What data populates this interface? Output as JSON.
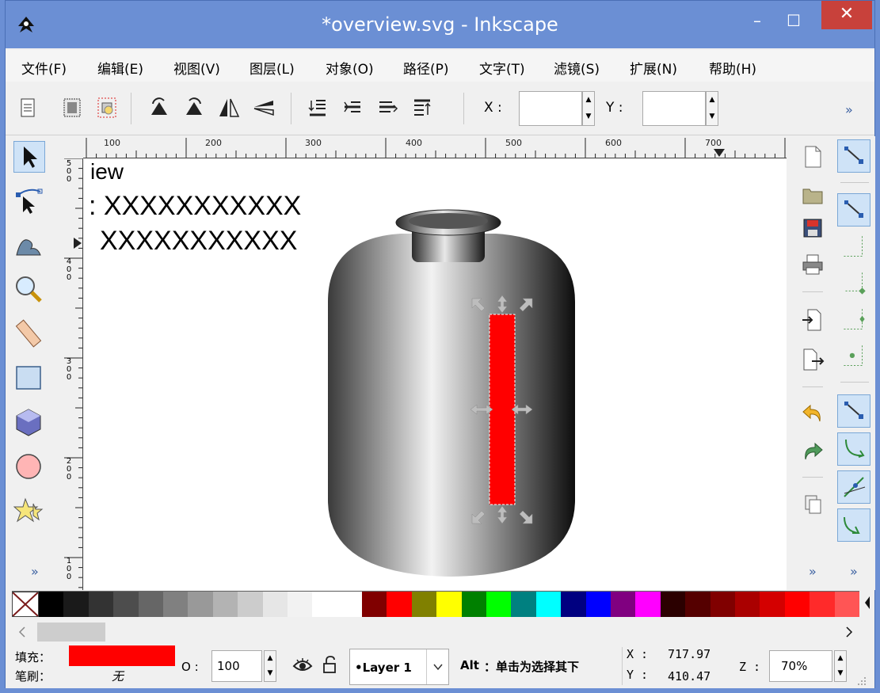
{
  "window": {
    "title": "*overview.svg - Inkscape",
    "minimize_glyph": "–",
    "maximize_glyph": "☐",
    "close_glyph": "✕"
  },
  "menu": [
    "文件(F)",
    "编辑(E)",
    "视图(V)",
    "图层(L)",
    "对象(O)",
    "路径(P)",
    "文字(T)",
    "滤镜(S)",
    "扩展(N)",
    "帮助(H)"
  ],
  "toolbar": {
    "x_label": "X :",
    "y_label": "Y :",
    "x_value": "",
    "y_value": "",
    "more": "»",
    "icons": [
      "select-all-icon",
      "select-all-layers-icon",
      "deselect-icon",
      "rotate-ccw-icon",
      "rotate-cw-icon",
      "flip-horizontal-icon",
      "flip-vertical-icon",
      "lower-bottom-icon",
      "lower-icon",
      "raise-icon",
      "raise-top-icon"
    ]
  },
  "tools": [
    "selector-icon",
    "node-editor-icon",
    "tweak-icon",
    "zoom-icon",
    "measure-icon",
    "rectangle-icon",
    "3d-box-icon",
    "ellipse-icon",
    "star-icon"
  ],
  "tools_more": "»",
  "ruler": {
    "h_ticks": [
      "100",
      "200",
      "300",
      "400",
      "500",
      "600",
      "700"
    ],
    "v_ticks": [
      "5\n0\n0",
      "4\n0\n0",
      "3\n0\n0",
      "2\n0\n0",
      "1\n0\n0"
    ]
  },
  "canvas": {
    "text_line1": "iew",
    "text_line2": ": XXXXXXXXXXX",
    "text_line3": "XXXXXXXXXXX"
  },
  "commands": [
    "new-document-icon",
    "open-folder-icon",
    "save-icon",
    "print-icon",
    "import-icon",
    "export-icon",
    "undo-icon",
    "redo-icon",
    "duplicate-icon"
  ],
  "commands_more": "»",
  "snap": [
    "snap-toggle-icon",
    "snap-bbox-icon",
    "snap-bbox-edge-icon",
    "snap-bbox-corner-icon",
    "snap-bbox-midpoint-icon",
    "snap-bbox-center-icon",
    "snap-nodes-icon",
    "snap-path-icon",
    "snap-path-intersection-icon",
    "snap-cusp-icon"
  ],
  "snap_more": "»",
  "palette": [
    "#000000",
    "#1a1a1a",
    "#333333",
    "#4d4d4d",
    "#666666",
    "#808080",
    "#999999",
    "#b3b3b3",
    "#cccccc",
    "#e6e6e6",
    "#f2f2f2",
    "#ffffff",
    "#ffffff",
    "#800000",
    "#ff0000",
    "#808000",
    "#ffff00",
    "#008000",
    "#00ff00",
    "#008080",
    "#00ffff",
    "#000080",
    "#0000ff",
    "#800080",
    "#ff00ff",
    "#2b0000",
    "#550000",
    "#800000",
    "#aa0000",
    "#d40000",
    "#ff0000",
    "#ff2a2a",
    "#ff5555"
  ],
  "status": {
    "fill_label": "填充：",
    "stroke_label": "笔刷：",
    "fill_color": "#ff0000",
    "stroke_value": "无",
    "opacity_label": "O :",
    "opacity_value": "100",
    "layer_name": "•Layer 1",
    "hint_key": "Alt",
    "hint_text": "：单击为选择其下",
    "x_label": "X :",
    "y_label": "Y :",
    "x_value": "717.97",
    "y_value": "410.47",
    "zoom_label": "Z :",
    "zoom_value": "70%"
  }
}
